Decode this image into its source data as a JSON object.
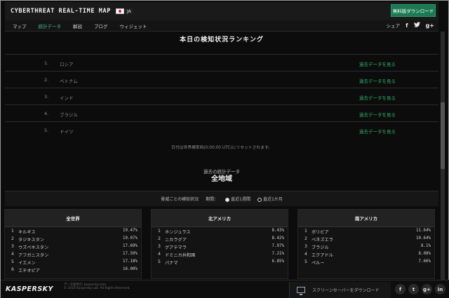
{
  "header": {
    "logo": "CYBERTHREAT REAL-TIME MAP",
    "language": "JA",
    "download_button": "無料版ダウンロード"
  },
  "nav": {
    "items": [
      {
        "label": "マップ",
        "active": false
      },
      {
        "label": "統計データ",
        "active": true
      },
      {
        "label": "解説",
        "active": false
      },
      {
        "label": "ブログ",
        "active": false
      },
      {
        "label": "ウィジェット",
        "active": false
      }
    ],
    "share_label": "シェア",
    "share_icons": [
      "facebook-icon",
      "twitter-icon",
      "google-plus-icon"
    ]
  },
  "ranking": {
    "title": "本日の検知状況ランキング",
    "rows": [
      {
        "rank": "1.",
        "country": "ロシア",
        "link": "過去データを見る"
      },
      {
        "rank": "2.",
        "country": "ベトナム",
        "link": "過去データを見る"
      },
      {
        "rank": "3.",
        "country": "インド",
        "link": "過去データを見る"
      },
      {
        "rank": "4.",
        "country": "ブラジル",
        "link": "過去データを見る"
      },
      {
        "rank": "5.",
        "country": "ドイツ",
        "link": "過去データを見る"
      }
    ],
    "note": "日付は世界標準時(0:00:00 UTC)にリセットされます。"
  },
  "past": {
    "label": "過去の統計データ",
    "title": "全地域"
  },
  "filter": {
    "label": "脅威ごとの検知状況",
    "period_label": "期間：",
    "options": [
      {
        "label": "直近1週間",
        "selected": true
      },
      {
        "label": "直近1か月",
        "selected": false
      }
    ]
  },
  "regions": [
    {
      "title": "全世界",
      "rows": [
        {
          "n": "1",
          "country": "キルギス",
          "pct": "19.47%"
        },
        {
          "n": "2",
          "country": "タジキスタン",
          "pct": "19.07%"
        },
        {
          "n": "3",
          "country": "ウズベキスタン",
          "pct": "17.69%"
        },
        {
          "n": "4",
          "country": "アフガニスタン",
          "pct": "17.50%"
        },
        {
          "n": "5",
          "country": "イエメン",
          "pct": "17.18%"
        },
        {
          "n": "6",
          "country": "エチオピア",
          "pct": "16.00%"
        }
      ]
    },
    {
      "title": "北アメリカ",
      "rows": [
        {
          "n": "1",
          "country": "ホンジュラス",
          "pct": "8.43%"
        },
        {
          "n": "2",
          "country": "ニカラグア",
          "pct": "8.42%"
        },
        {
          "n": "3",
          "country": "グアテマラ",
          "pct": "7.97%"
        },
        {
          "n": "4",
          "country": "ドミニカ共和国",
          "pct": "7.21%"
        },
        {
          "n": "5",
          "country": "パナマ",
          "pct": "6.85%"
        }
      ]
    },
    {
      "title": "南アメリカ",
      "rows": [
        {
          "n": "1",
          "country": "ボリビア",
          "pct": "11.64%"
        },
        {
          "n": "2",
          "country": "ベネズエラ",
          "pct": "10.64%"
        },
        {
          "n": "3",
          "country": "ブラジル",
          "pct": "8.1%"
        },
        {
          "n": "4",
          "country": "エクアドル",
          "pct": "8.08%"
        },
        {
          "n": "5",
          "country": "ペルー",
          "pct": "7.66%"
        }
      ]
    }
  ],
  "footer": {
    "logo": "KASPERSKY",
    "copy_line1": "データ提供元: kaspersky.com",
    "copy_line2": "© 2016 Kaspersky Lab. All Rights Reserved.",
    "screensaver_label": "スクリーンセーバーをダウンロード",
    "social_icons": [
      "facebook-icon",
      "twitter-icon",
      "google-plus-icon",
      "linkedin-icon"
    ]
  }
}
